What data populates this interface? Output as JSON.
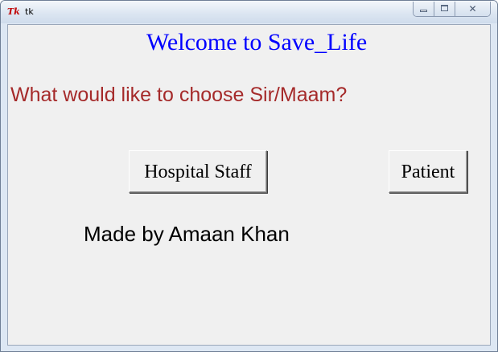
{
  "window": {
    "title": "tk",
    "icon": "tk-feather-icon",
    "controls": {
      "minimize": "minimize-icon",
      "maximize": "maximize-icon",
      "close": "close-icon"
    }
  },
  "main": {
    "heading": "Welcome to Save_Life",
    "heading_color": "#0000ff",
    "question": "What would like to choose Sir/Maam?",
    "question_color": "#a52a2a",
    "buttons": {
      "hospital_staff": "Hospital Staff",
      "patient": "Patient"
    },
    "credit": "Made by Amaan Khan"
  }
}
